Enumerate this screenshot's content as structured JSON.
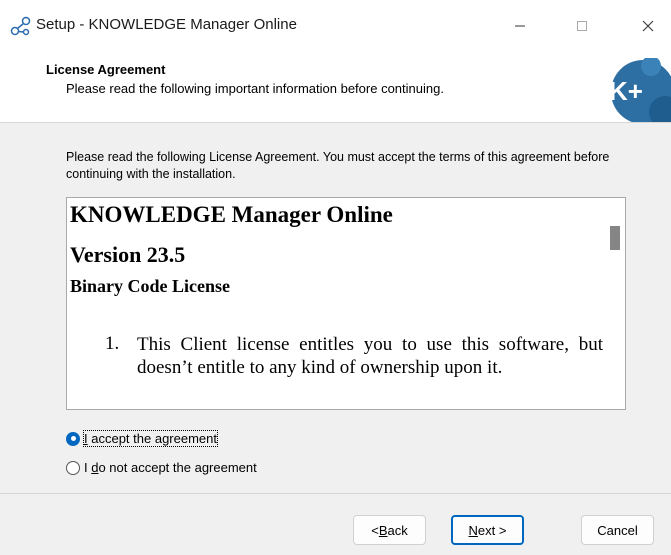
{
  "window": {
    "title": "Setup - KNOWLEDGE Manager Online"
  },
  "header": {
    "title": "License Agreement",
    "subtitle": "Please read the following important information before continuing.",
    "logo_text": "K+"
  },
  "body": {
    "intro": "Please read the following License Agreement. You must accept the terms of this agreement before continuing with the installation."
  },
  "license": {
    "product": "KNOWLEDGE Manager Online",
    "version": "Version 23.5",
    "license_type": "Binary Code License",
    "clause_number": "1.",
    "clause_text": "This Client license entitles you to use this software, but doesn’t entitle to any kind of ownership upon it."
  },
  "options": {
    "accept": {
      "pre": "",
      "key": "I",
      "post": " accept the agreement",
      "checked": true
    },
    "decline": {
      "pre": "I ",
      "key": "d",
      "post": "o not accept the agreement",
      "checked": false
    }
  },
  "buttons": {
    "back": {
      "pre": "< ",
      "key": "B",
      "post": "ack"
    },
    "next": {
      "pre": "",
      "key": "N",
      "post": "ext >"
    },
    "cancel": "Cancel"
  },
  "colors": {
    "accent": "#0067c0",
    "logo_blue": "#1e5d8e"
  }
}
